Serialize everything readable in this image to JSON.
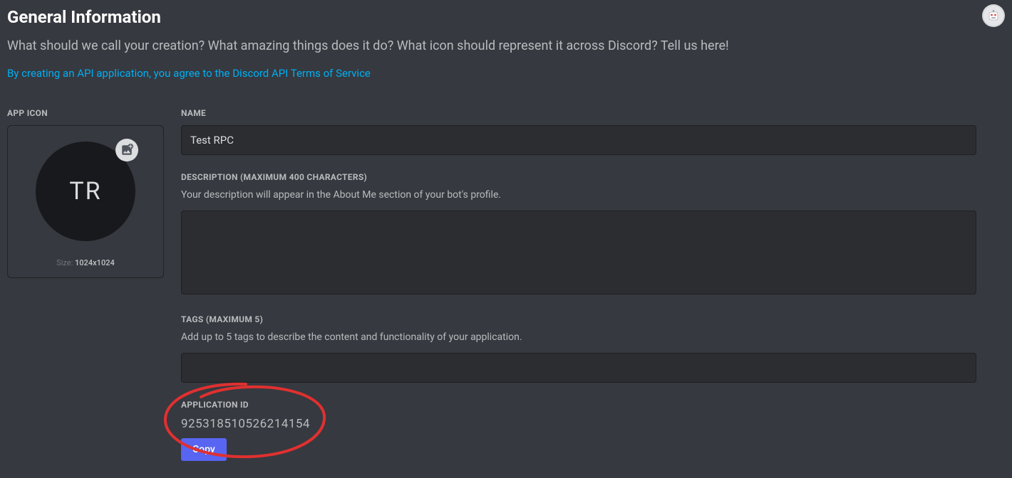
{
  "header": {
    "title": "General Information",
    "subtitle": "What should we call your creation? What amazing things does it do? What icon should represent it across Discord? Tell us here!",
    "tos_text": "By creating an API application, you agree to the Discord API Terms of Service"
  },
  "app_icon": {
    "label": "APP ICON",
    "initials": "TR",
    "size_prefix": "Size: ",
    "size_value": "1024x1024"
  },
  "name": {
    "label": "NAME",
    "value": "Test RPC"
  },
  "description": {
    "label": "DESCRIPTION (MAXIMUM 400 CHARACTERS)",
    "helper": "Your description will appear in the About Me section of your bot's profile.",
    "value": ""
  },
  "tags": {
    "label": "TAGS (MAXIMUM 5)",
    "helper": "Add up to 5 tags to describe the content and functionality of your application.",
    "value": ""
  },
  "application_id": {
    "label": "APPLICATION ID",
    "value": "925318510526214154",
    "copy_label": "Copy"
  }
}
